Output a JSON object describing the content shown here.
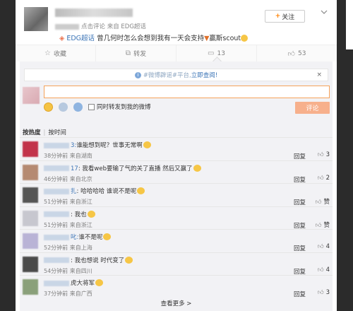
{
  "post": {
    "meta_text": "点击评论 来自 EDG超话",
    "follow_label": "关注",
    "topic_tag": "EDG超话",
    "text": "曾几何时怎么会想到我有一天会支持",
    "text_tail": "赢斯scout"
  },
  "actions": [
    {
      "label": "收藏",
      "icon": "star-icon"
    },
    {
      "label": "转发",
      "icon": "share-icon"
    },
    {
      "label": "13",
      "icon": "comment-icon"
    },
    {
      "label": "53",
      "icon": "like-icon"
    }
  ],
  "notice": {
    "hash_text": "#微博辟谣#平台,",
    "link_text": "立即查阅!",
    "close": "×"
  },
  "composer": {
    "forward_label": "同时转发到我的微博",
    "submit_label": "评论"
  },
  "sort": {
    "hot": "按热度",
    "time": "按时间"
  },
  "comments": [
    {
      "name_suffix": "3:",
      "text": "谁能想到呢？世事无常啊",
      "time": "38分钟前",
      "from": "来自湖南",
      "reply": "回复",
      "likes": "3",
      "avatar": "#c2334a"
    },
    {
      "name_suffix": "17",
      "text": ": 我看web要输了气的关了直播 然后又赢了",
      "time": "46分钟前",
      "from": "来自北京",
      "reply": "回复",
      "likes": "2",
      "avatar": "#b58a72"
    },
    {
      "name_suffix": "扎",
      "text": ": 哈哈哈哈 谁说不是呢",
      "time": "51分钟前",
      "from": "来自浙江",
      "reply": "回复",
      "likes": "赞",
      "avatar": "#555555"
    },
    {
      "name_suffix": "",
      "text": ": 我也",
      "time": "51分钟前",
      "from": "来自浙江",
      "reply": "回复",
      "likes": "赞",
      "avatar": "#c7c7cf"
    },
    {
      "name_suffix": "叱:",
      "text": "谁不是呢",
      "time": "52分钟前",
      "from": "来自上海",
      "reply": "回复",
      "likes": "4",
      "avatar": "#b9b3d6"
    },
    {
      "name_suffix": "",
      "text": ": 我也想说 时代变了",
      "time": "54分钟前",
      "from": "来自四川",
      "reply": "回复",
      "likes": "4",
      "avatar": "#4a4a4a"
    },
    {
      "name_suffix": "",
      "text": "虎大将军",
      "time": "37分钟前",
      "from": "来自广西",
      "reply": "回复",
      "likes": "3",
      "avatar": "#8aa07a"
    }
  ],
  "more_label": "查看更多 >"
}
